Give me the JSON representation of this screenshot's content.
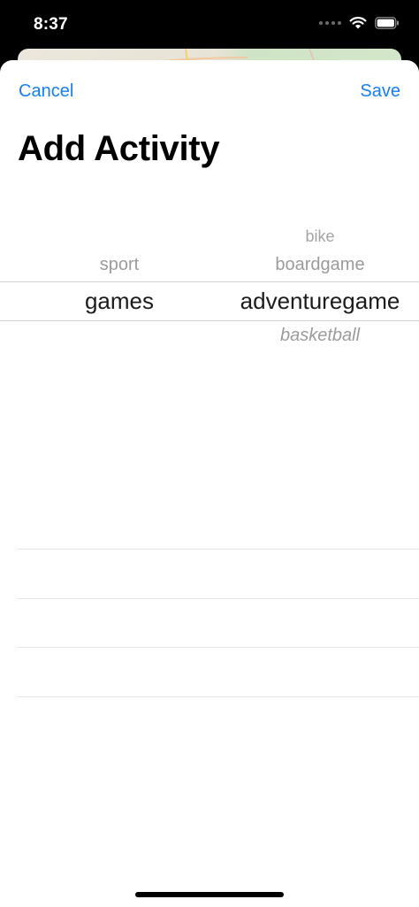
{
  "status_bar": {
    "time": "8:37"
  },
  "nav": {
    "cancel_label": "Cancel",
    "save_label": "Save"
  },
  "title": "Add Activity",
  "picker": {
    "column_category": {
      "above": "sport",
      "selected": "games"
    },
    "column_activity": {
      "above_2": "bike",
      "above_1": "boardgame",
      "selected": "adventuregame",
      "below_1": "basketball"
    }
  },
  "colors": {
    "accent": "#1a7ef2",
    "sheet_background": "#ffffff",
    "status_bar_background": "#000000"
  }
}
